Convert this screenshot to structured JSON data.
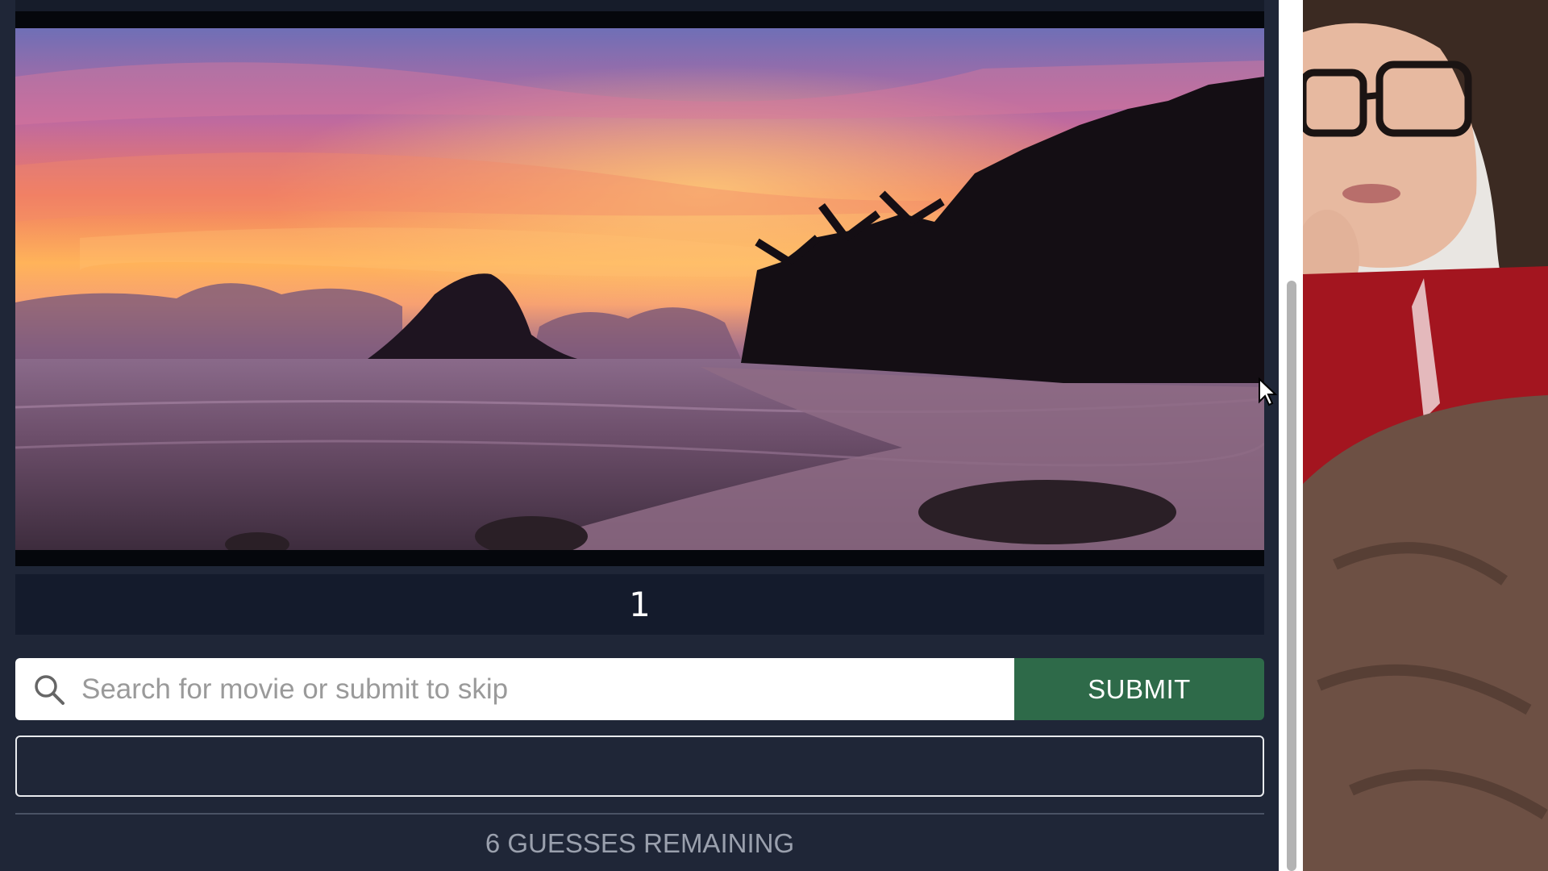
{
  "frame": {
    "counter": "1",
    "scene_description_icon": "sunset-beach-frame"
  },
  "search": {
    "placeholder": "Search for movie or submit to skip",
    "value": "",
    "icon": "search-icon"
  },
  "submit": {
    "label": "SUBMIT"
  },
  "guesses": {
    "remaining_label": "6 GUESSES REMAINING",
    "remaining_count": 6
  },
  "colors": {
    "background": "#1f2637",
    "submit_green": "#2e6a49",
    "counter_bar": "#141b2c"
  }
}
